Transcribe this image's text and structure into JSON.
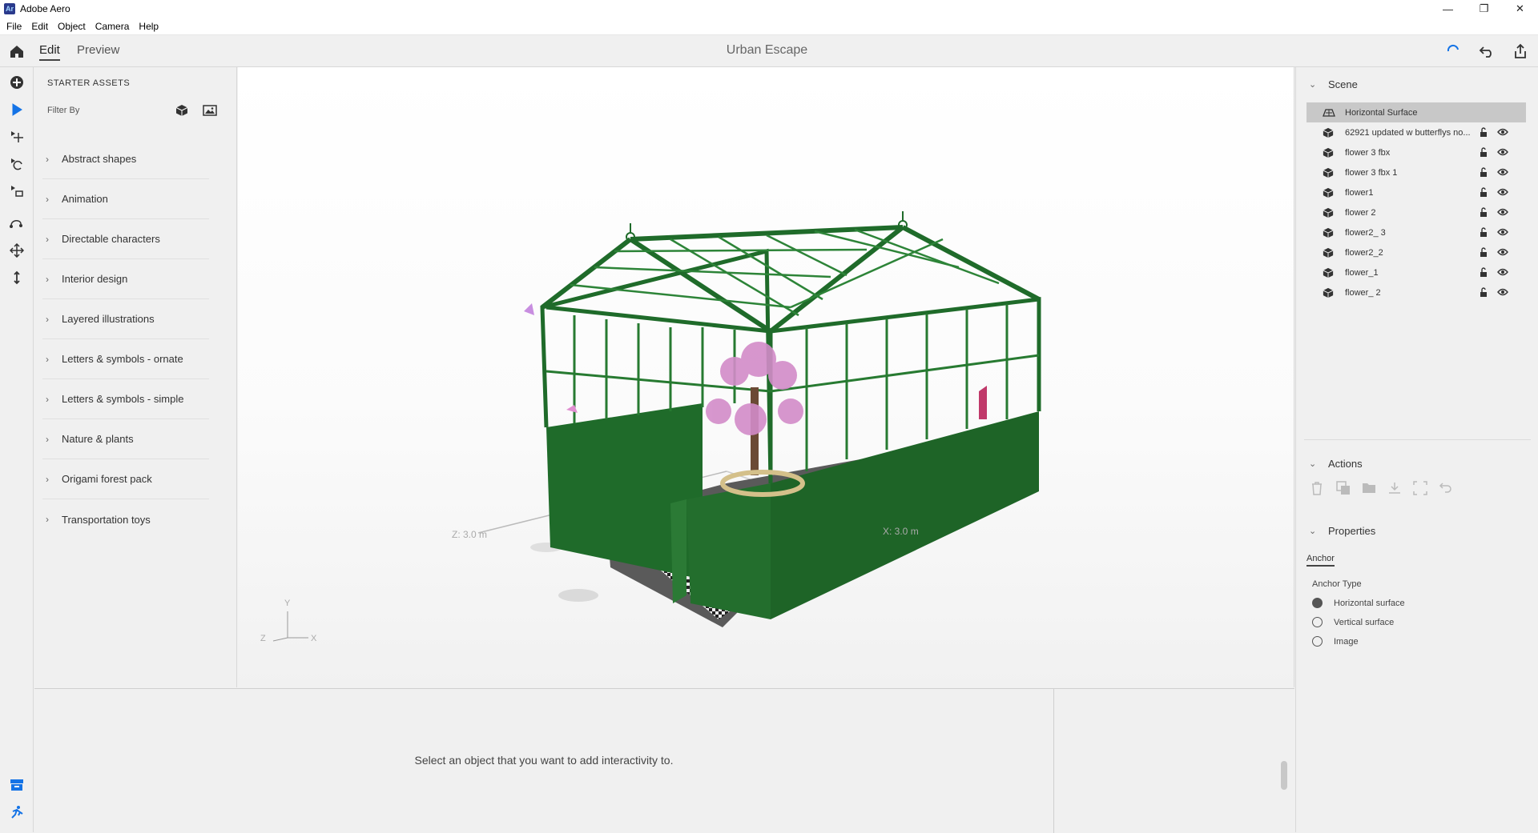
{
  "window": {
    "app_icon": "Ar",
    "title": "Adobe Aero"
  },
  "menu": [
    "File",
    "Edit",
    "Object",
    "Camera",
    "Help"
  ],
  "appbar": {
    "tabs": [
      "Edit",
      "Preview"
    ],
    "doc_title": "Urban Escape"
  },
  "assets": {
    "header": "STARTER ASSETS",
    "filter_label": "Filter By",
    "categories": [
      "Abstract shapes",
      "Animation",
      "Directable characters",
      "Interior design",
      "Layered illustrations",
      "Letters & symbols - ornate",
      "Letters & symbols - simple",
      "Nature & plants",
      "Origami forest pack",
      "Transportation toys"
    ]
  },
  "viewport": {
    "z_label": "Z:  3.0 m",
    "x_label": "X:  3.0 m",
    "gizmo": {
      "y": "Y",
      "z": "Z",
      "x": "X"
    }
  },
  "bottom": {
    "message": "Select an object that you want to add interactivity to."
  },
  "scene": {
    "title": "Scene",
    "items": [
      "Horizontal Surface",
      "62921 updated w butterflys no...",
      "flower 3 fbx",
      "flower 3 fbx 1",
      "flower1",
      "flower 2",
      "flower2_ 3",
      "flower2_2",
      "flower_1",
      "flower_ 2"
    ]
  },
  "actions": {
    "title": "Actions"
  },
  "properties": {
    "title": "Properties",
    "tab": "Anchor",
    "anchor_type_label": "Anchor Type",
    "options": [
      "Horizontal surface",
      "Vertical surface",
      "Image"
    ],
    "selected_index": 0
  },
  "colors": {
    "accent": "#1473e6",
    "greenhouse": "#1f6b2a",
    "selected_row": "#c8c8c8"
  }
}
